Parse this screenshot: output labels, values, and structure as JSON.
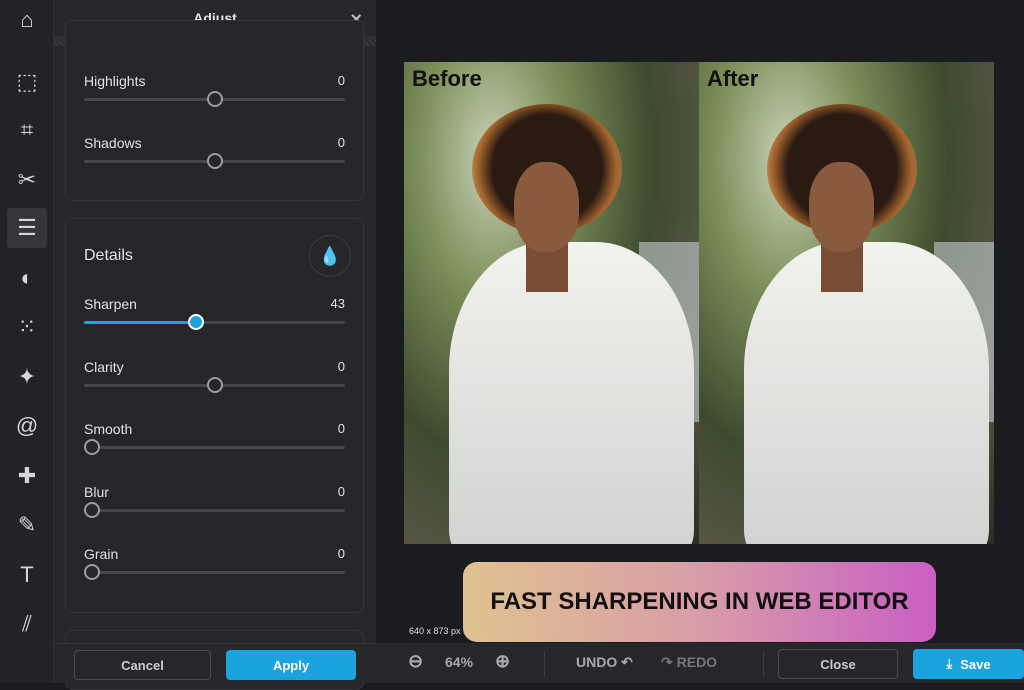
{
  "panel": {
    "title": "Adjust",
    "close_label": "×"
  },
  "light": [
    {
      "label": "Highlights",
      "value": "0",
      "fraction": 0.5
    },
    {
      "label": "Shadows",
      "value": "0",
      "fraction": 0.5
    }
  ],
  "details": {
    "title": "Details",
    "sliders": [
      {
        "label": "Sharpen",
        "value": "43",
        "fraction": 0.43
      },
      {
        "label": "Clarity",
        "value": "0",
        "fraction": 0.5
      },
      {
        "label": "Smooth",
        "value": "0",
        "fraction": 0
      },
      {
        "label": "Blur",
        "value": "0",
        "fraction": 0
      },
      {
        "label": "Grain",
        "value": "0",
        "fraction": 0
      }
    ]
  },
  "buttons": {
    "cancel": "Cancel",
    "apply": "Apply",
    "close": "Close",
    "save": "Save",
    "undo": "UNDO",
    "redo": "REDO"
  },
  "zoom": "64%",
  "image": {
    "before": "Before",
    "after": "After",
    "dims": "640 x 873 px @ 64%"
  },
  "banner": "FAST SHARPENING IN WEB EDITOR",
  "colors": {
    "accent": "#1aa3dc"
  }
}
